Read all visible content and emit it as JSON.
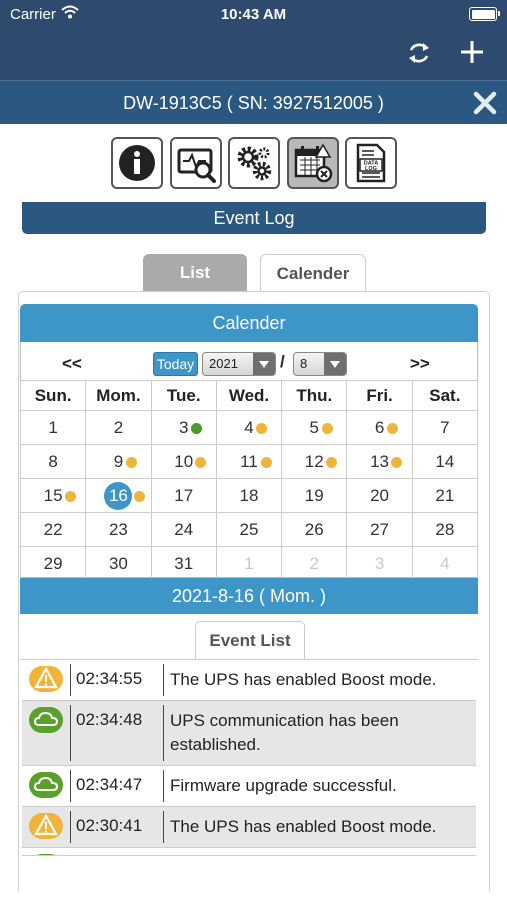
{
  "status_bar": {
    "carrier": "Carrier",
    "time": "10:43 AM"
  },
  "header": {
    "title": "DW-1913C5 ( SN: 3927512005 )"
  },
  "toolbar": {
    "items": [
      {
        "icon": "info-icon",
        "active": false
      },
      {
        "icon": "monitor-icon",
        "active": false
      },
      {
        "icon": "settings-gears-icon",
        "active": false
      },
      {
        "icon": "event-calendar-icon",
        "active": true
      },
      {
        "icon": "data-log-icon",
        "active": false,
        "label": "DATA LOG"
      }
    ]
  },
  "section_title": "Event Log",
  "tabs": {
    "list": "List",
    "calendar": "Calender"
  },
  "calendar": {
    "title": "Calender",
    "prev": "<<",
    "next": ">>",
    "today": "Today",
    "year": "2021",
    "month": "8",
    "separator": "/",
    "weekdays": [
      "Sun.",
      "Mom.",
      "Tue.",
      "Wed.",
      "Thu.",
      "Fri.",
      "Sat."
    ],
    "weeks": [
      [
        {
          "d": "1"
        },
        {
          "d": "2"
        },
        {
          "d": "3",
          "dot": "green"
        },
        {
          "d": "4",
          "dot": "yellow"
        },
        {
          "d": "5",
          "dot": "yellow"
        },
        {
          "d": "6",
          "dot": "yellow"
        },
        {
          "d": "7"
        }
      ],
      [
        {
          "d": "8"
        },
        {
          "d": "9",
          "dot": "yellow"
        },
        {
          "d": "10",
          "dot": "yellow"
        },
        {
          "d": "11",
          "dot": "yellow"
        },
        {
          "d": "12",
          "dot": "yellow"
        },
        {
          "d": "13",
          "dot": "yellow"
        },
        {
          "d": "14"
        }
      ],
      [
        {
          "d": "15",
          "dot": "yellow"
        },
        {
          "d": "16",
          "dot": "yellow",
          "selected": true
        },
        {
          "d": "17"
        },
        {
          "d": "18"
        },
        {
          "d": "19"
        },
        {
          "d": "20"
        },
        {
          "d": "21"
        }
      ],
      [
        {
          "d": "22"
        },
        {
          "d": "23"
        },
        {
          "d": "24"
        },
        {
          "d": "25"
        },
        {
          "d": "26"
        },
        {
          "d": "27"
        },
        {
          "d": "28"
        }
      ],
      [
        {
          "d": "29"
        },
        {
          "d": "30"
        },
        {
          "d": "31"
        },
        {
          "d": "1",
          "other": true
        },
        {
          "d": "2",
          "other": true
        },
        {
          "d": "3",
          "other": true
        },
        {
          "d": "4",
          "other": true
        }
      ]
    ],
    "dot_colors": {
      "yellow": "#f0b43a",
      "green": "#4a9a2a"
    }
  },
  "selected_date": "2021-8-16 ( Mom. )",
  "event_list": {
    "tab_label": "Event List",
    "events": [
      {
        "type": "warning-icon",
        "time": "02:34:55",
        "message": "The UPS has enabled Boost mode."
      },
      {
        "type": "cloud-icon",
        "time": "02:34:48",
        "message": "UPS communication has been established."
      },
      {
        "type": "cloud-icon",
        "time": "02:34:47",
        "message": "Firmware upgrade successful."
      },
      {
        "type": "warning-icon",
        "time": "02:30:41",
        "message": "The UPS has enabled Boost mode."
      }
    ]
  },
  "colors": {
    "nav": "#2e4a6e",
    "header": "#2b5880",
    "accent": "#3d95c8",
    "warning": "#f0b43a",
    "ok": "#5aa02c"
  }
}
